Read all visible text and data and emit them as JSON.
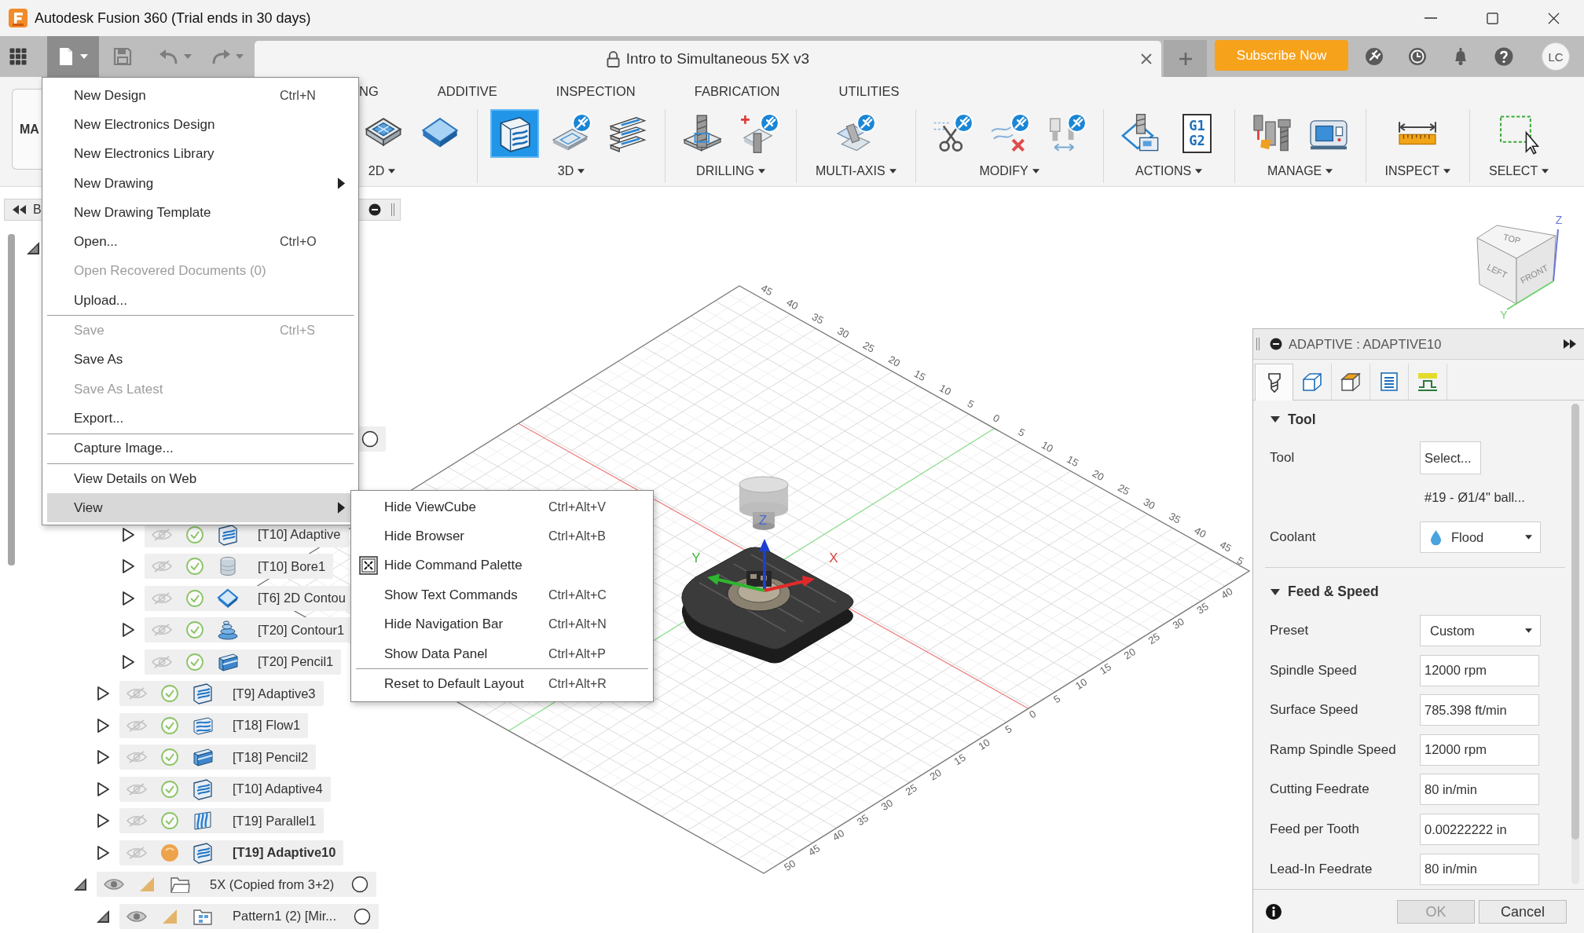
{
  "window": {
    "title": "Autodesk Fusion 360 (Trial ends in 30 days)"
  },
  "app_bar": {
    "file_menu_open": true,
    "document": {
      "title": "Intro to Simultaneous 5X v3",
      "locked": true
    },
    "subscribe": "Subscribe Now",
    "avatar": "LC"
  },
  "toolbar": {
    "workspace": "MA",
    "tabs": [
      "NG",
      "ADDITIVE",
      "INSPECTION",
      "FABRICATION",
      "UTILITIES"
    ],
    "groups": [
      {
        "label": "2D",
        "tools": [
          {
            "selected": false
          },
          {
            "selected": false
          }
        ]
      },
      {
        "label": "3D",
        "tools": [
          {
            "selected": true
          },
          {
            "selected": false
          },
          {
            "selected": false
          }
        ]
      },
      {
        "label": "DRILLING",
        "tools": [
          {
            "selected": false
          },
          {
            "selected": false
          }
        ]
      },
      {
        "label": "MULTI-AXIS",
        "tools": [
          {
            "selected": false
          }
        ]
      },
      {
        "label": "MODIFY",
        "tools": [
          {
            "selected": false
          },
          {
            "selected": false
          },
          {
            "selected": false
          }
        ]
      },
      {
        "label": "ACTIONS",
        "tools": [
          {
            "selected": false
          },
          {
            "selected": false,
            "text": [
              "G1",
              "G2"
            ]
          }
        ]
      },
      {
        "label": "MANAGE",
        "tools": [
          {
            "selected": false
          },
          {
            "selected": false
          }
        ]
      },
      {
        "label": "INSPECT",
        "tools": [
          {
            "selected": false
          }
        ]
      },
      {
        "label": "SELECT",
        "tools": [
          {
            "selected": false
          }
        ]
      }
    ]
  },
  "file_menu": {
    "groups": [
      {
        "items": [
          {
            "label": "New Design",
            "shortcut": "Ctrl+N",
            "disabled": false,
            "selected": false
          },
          {
            "label": "New Electronics Design",
            "disabled": false,
            "selected": false
          },
          {
            "label": "New Electronics Library",
            "disabled": false,
            "selected": false
          },
          {
            "label": "New Drawing",
            "submenu": true,
            "disabled": false,
            "selected": false
          },
          {
            "label": "New Drawing Template",
            "disabled": false,
            "selected": false
          },
          {
            "label": "Open...",
            "shortcut": "Ctrl+O",
            "disabled": false,
            "selected": false
          },
          {
            "label": "Open Recovered Documents (0)",
            "disabled": true,
            "selected": false
          },
          {
            "label": "Upload...",
            "disabled": false,
            "selected": false
          }
        ]
      },
      {
        "items": [
          {
            "label": "Save",
            "shortcut": "Ctrl+S",
            "disabled": true,
            "selected": false
          },
          {
            "label": "Save As",
            "disabled": false,
            "selected": false
          },
          {
            "label": "Save As Latest",
            "disabled": true,
            "selected": false
          },
          {
            "label": "Export...",
            "disabled": false,
            "selected": false
          }
        ]
      },
      {
        "items": [
          {
            "label": "Capture Image...",
            "disabled": false,
            "selected": false
          }
        ]
      },
      {
        "items": [
          {
            "label": "View Details on Web",
            "disabled": false,
            "selected": false
          },
          {
            "label": "View",
            "submenu": true,
            "disabled": false,
            "selected": true
          }
        ]
      }
    ]
  },
  "view_submenu": {
    "groups": [
      {
        "items": [
          {
            "label": "Hide ViewCube",
            "shortcut": "Ctrl+Alt+V",
            "checked": false
          },
          {
            "label": "Hide Browser",
            "shortcut": "Ctrl+Alt+B",
            "checked": false
          },
          {
            "label": "Hide Command Palette",
            "checked": true
          },
          {
            "label": "Show Text Commands",
            "shortcut": "Ctrl+Alt+C",
            "checked": false
          },
          {
            "label": "Hide Navigation Bar",
            "shortcut": "Ctrl+Alt+N",
            "checked": false
          },
          {
            "label": "Show Data Panel",
            "shortcut": "Ctrl+Alt+P",
            "checked": false
          }
        ]
      },
      {
        "items": [
          {
            "label": "Reset to Default Layout",
            "shortcut": "Ctrl+Alt+R",
            "checked": false
          }
        ]
      }
    ]
  },
  "browser": {
    "title": "B",
    "tree": [
      {
        "kind": "root",
        "expanded": true,
        "children": [
          {
            "kind": "setup",
            "active": false,
            "children": [
              {
                "kind": "folder",
                "children": [
                  {
                    "kind": "adaptive",
                    "label": "[T10] Adaptive",
                    "expanded": false,
                    "visible": false,
                    "editing": false
                  },
                  {
                    "kind": "bore",
                    "label": "[T10] Bore1",
                    "expanded": false,
                    "visible": false,
                    "editing": false
                  },
                  {
                    "kind": "contour2d",
                    "label": "[T6] 2D Contou",
                    "expanded": false,
                    "visible": false,
                    "editing": false
                  },
                  {
                    "kind": "contour",
                    "label": "[T20] Contour1",
                    "expanded": false,
                    "visible": false,
                    "editing": false
                  },
                  {
                    "kind": "pencil",
                    "label": "[T20] Pencil1",
                    "expanded": false,
                    "visible": false,
                    "editing": false
                  }
                ]
              },
              {
                "kind": "adaptive",
                "label": "[T9] Adaptive3",
                "expanded": false,
                "visible": false,
                "editing": false
              },
              {
                "kind": "flow",
                "label": "[T18] Flow1",
                "expanded": false,
                "visible": false,
                "editing": false
              },
              {
                "kind": "pencil",
                "label": "[T18] Pencil2",
                "expanded": false,
                "visible": false,
                "editing": false
              },
              {
                "kind": "adaptive",
                "label": "[T10] Adaptive4",
                "expanded": false,
                "visible": false,
                "editing": false
              },
              {
                "kind": "parallel",
                "label": "[T19] Parallel1",
                "expanded": false,
                "visible": false,
                "editing": false
              },
              {
                "kind": "adaptive",
                "label": "[T19] Adaptive10",
                "expanded": false,
                "visible": false,
                "editing": true
              }
            ]
          },
          {
            "kind": "setup",
            "label": "5X (Copied from 3+2)",
            "expanded": true,
            "visible": true,
            "active": false,
            "children": [
              {
                "kind": "pattern",
                "label": "Pattern1 (2) [Mir...",
                "expanded": true,
                "visible": true,
                "active": false
              }
            ]
          }
        ]
      }
    ]
  },
  "viewport": {
    "view_cube": {
      "top": "TOP",
      "left": "LEFT",
      "front": "FRONT",
      "z_axis": "Z",
      "y_axis": "Y"
    },
    "grid": {
      "upper_edge_labels": [
        "45",
        "40",
        "35",
        "30",
        "25",
        "20",
        "15",
        "10",
        "5",
        "0",
        "5",
        "10",
        "15",
        "20",
        "25",
        "30",
        "35",
        "40",
        "45",
        "5"
      ],
      "lower_edge_labels": [
        "40",
        "35",
        "30",
        "25",
        "20",
        "15",
        "10",
        "5",
        "0",
        "5",
        "10",
        "15",
        "20",
        "25",
        "30",
        "35",
        "40",
        "45",
        "50"
      ]
    },
    "triad": {
      "x": "X",
      "y": "Y",
      "z": "Z"
    }
  },
  "operation_panel": {
    "title": "ADAPTIVE : ADAPTIVE10",
    "tabs": [
      {
        "selected": true
      },
      {
        "selected": false
      },
      {
        "selected": false
      },
      {
        "selected": false
      },
      {
        "selected": false
      }
    ],
    "sections": [
      {
        "title": "Tool",
        "expanded": true,
        "rows": [
          {
            "kind": "button",
            "label": "Tool",
            "value": "Select..."
          },
          {
            "kind": "note",
            "value": "#19 - Ø1/4\" ball..."
          },
          {
            "kind": "coolant",
            "label": "Coolant",
            "value": "Flood"
          }
        ]
      },
      {
        "title": "Feed & Speed",
        "expanded": true,
        "rows": [
          {
            "kind": "dropdown",
            "label": "Preset",
            "value": "Custom"
          },
          {
            "kind": "field",
            "label": "Spindle Speed",
            "value": "12000 rpm"
          },
          {
            "kind": "field",
            "label": "Surface Speed",
            "value": "785.398 ft/min"
          },
          {
            "kind": "field",
            "label": "Ramp Spindle Speed",
            "value": "12000 rpm"
          },
          {
            "kind": "field",
            "label": "Cutting Feedrate",
            "value": "80 in/min"
          },
          {
            "kind": "field",
            "label": "Feed per Tooth",
            "value": "0.00222222 in"
          },
          {
            "kind": "field",
            "label": "Lead-In Feedrate",
            "value": "80 in/min"
          }
        ]
      }
    ],
    "buttons": [
      {
        "label": "OK",
        "disabled": true
      },
      {
        "label": "Cancel",
        "disabled": false
      }
    ]
  }
}
